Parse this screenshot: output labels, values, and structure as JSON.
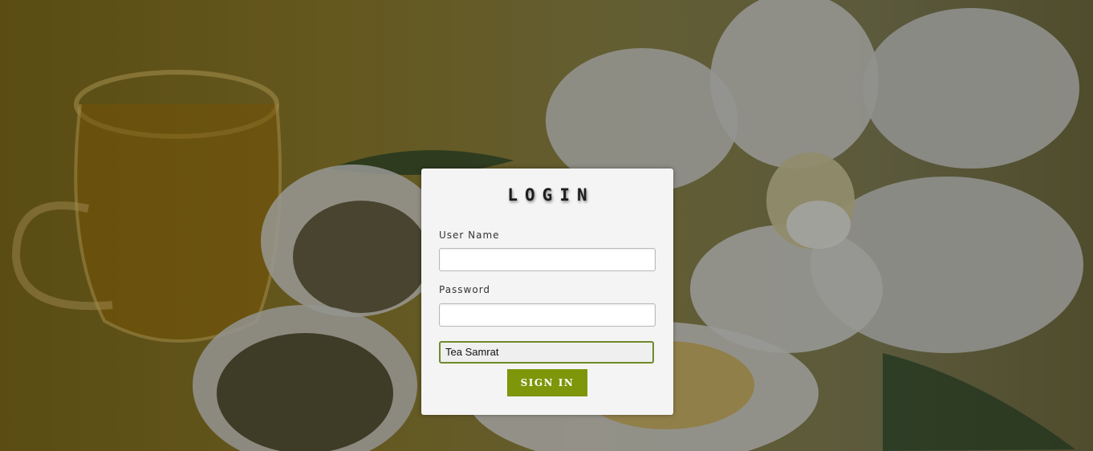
{
  "login": {
    "title": "LOGIN",
    "username_label": "User Name",
    "username_value": "",
    "password_label": "Password",
    "password_value": "",
    "store_selected": "Tea Samrat",
    "sign_in_label": "SIGN IN"
  },
  "colors": {
    "button": "#7d960a",
    "select_border": "#6f8a2a",
    "card_background": "#f4f4f4"
  }
}
